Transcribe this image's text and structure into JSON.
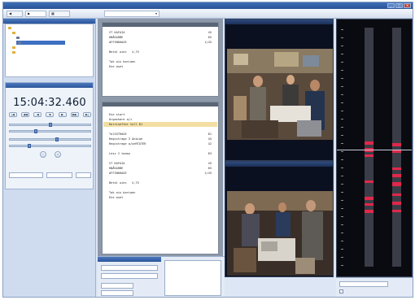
{
  "window": {
    "title": "",
    "right_title": "",
    "buttons": [
      "_",
      "▢",
      "✕"
    ]
  },
  "toolbar": {
    "items": [
      {
        "label": "",
        "icon": "back-icon"
      },
      {
        "label": "",
        "icon": "playback-icon"
      },
      {
        "label": "",
        "icon": "layout-icon"
      }
    ],
    "combo_value": ""
  },
  "tree": {
    "header": "",
    "items": [
      {
        "label": "",
        "icon": "folder-icon"
      },
      {
        "label": "",
        "icon": "folder-icon"
      },
      {
        "label": "",
        "icon": "camera-icon"
      },
      {
        "label": "",
        "icon": "camera-icon",
        "selected": true
      },
      {
        "label": "",
        "icon": "folder-icon"
      },
      {
        "label": "",
        "icon": "folder-icon"
      }
    ]
  },
  "navigation": {
    "header": "",
    "clock": "15:04:32.460",
    "controls": [
      "|◀",
      "◀◀",
      "◀",
      "■",
      "▶",
      "▶▶",
      "▶|"
    ],
    "speed_controls": [
      "−",
      "+"
    ]
  },
  "receipt_top": {
    "lines": [
      {
        "text": "ST KAFAIA",
        "value": "45"
      },
      {
        "text": "KNÅSARBE",
        "value": "65"
      },
      {
        "text": "AFFINKHAGE",
        "value": "1/45"
      },
      {
        "text": "",
        "value": ""
      },
      {
        "text": "Betal oiec   4,75",
        "value": ""
      },
      {
        "text": "",
        "value": ""
      },
      {
        "text": "Tak oiu bariaen",
        "value": ""
      },
      {
        "text": "Ene aset",
        "value": ""
      }
    ]
  },
  "receipt_bottom": {
    "lines": [
      {
        "text": "Ene start",
        "value": ""
      },
      {
        "text": "Orgashare a/i",
        "value": ""
      },
      {
        "text": "Korrisefter tull 81",
        "value": "",
        "highlight": true
      },
      {
        "text": "",
        "value": ""
      },
      {
        "text": "TalSGTRAGE",
        "value": "81"
      },
      {
        "text": "Registrage 3 Ankiae",
        "value": "45"
      },
      {
        "text": "Registrage a/ueRTATER",
        "value": "42"
      },
      {
        "text": "",
        "value": ""
      },
      {
        "text": "Lesz 2 taaau",
        "value": "83"
      },
      {
        "text": "",
        "value": ""
      },
      {
        "text": "ST KAFAIA",
        "value": "45"
      },
      {
        "text": "KNÅSARBE",
        "value": "65"
      },
      {
        "text": "AFFINKHAGE",
        "value": "1/45"
      },
      {
        "text": "",
        "value": ""
      },
      {
        "text": "Betal oiec   4,75",
        "value": ""
      },
      {
        "text": "",
        "value": ""
      },
      {
        "text": "Tak oiu bariaen",
        "value": ""
      },
      {
        "text": "Ene aset",
        "value": ""
      }
    ]
  },
  "timeline": {
    "label_top_left": "",
    "label_top_right": "",
    "label_bottom_left": "",
    "label_bottom_right": "",
    "colors": {
      "marker": "#e0284a",
      "track": "#3a3d47"
    }
  },
  "bottom_right": {
    "select_value": "",
    "checkbox_label": ""
  }
}
